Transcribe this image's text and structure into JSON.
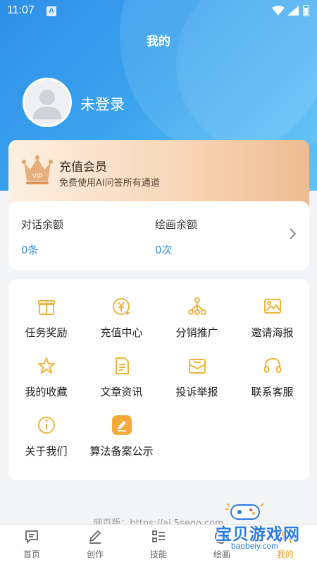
{
  "status_bar": {
    "time": "11:07",
    "notification_icon": "A"
  },
  "header": {
    "title": "我的"
  },
  "profile": {
    "login_text": "未登录",
    "avatar_icon": "default-avatar-icon"
  },
  "vip": {
    "title": "充值会员",
    "subtitle": "免费使用AI问答所有通道",
    "crown_text": "VIP"
  },
  "balance": {
    "chat_label": "对话余额",
    "chat_value": "0条",
    "draw_label": "绘画余额",
    "draw_value": "0次"
  },
  "menu": [
    {
      "label": "任务奖励",
      "icon": "gift-icon"
    },
    {
      "label": "充值中心",
      "icon": "yen-coin-icon"
    },
    {
      "label": "分销推广",
      "icon": "share-tree-icon"
    },
    {
      "label": "邀请海报",
      "icon": "image-icon"
    },
    {
      "label": "我的收藏",
      "icon": "star-icon"
    },
    {
      "label": "文章资讯",
      "icon": "document-icon"
    },
    {
      "label": "投诉举报",
      "icon": "mail-report-icon"
    },
    {
      "label": "联系客服",
      "icon": "headset-icon"
    },
    {
      "label": "关于我们",
      "icon": "info-icon"
    },
    {
      "label": "算法备案公示",
      "icon": "edit-badge-icon"
    }
  ],
  "footer": {
    "web_version": "网页版：https://ai.5sego.com"
  },
  "tabs": [
    {
      "label": "首页",
      "icon": "chat-icon"
    },
    {
      "label": "创作",
      "icon": "pen-icon"
    },
    {
      "label": "技能",
      "icon": "list-icon"
    },
    {
      "label": "绘画",
      "icon": "palette-icon"
    },
    {
      "label": "我的",
      "icon": "user-icon"
    }
  ],
  "watermark": {
    "text": "宝贝游戏网",
    "url": "baobeiy.com"
  },
  "colors": {
    "primary_blue": "#3a8fe0",
    "accent_gold": "#f0b43c",
    "active_tab": "#f0a020"
  }
}
